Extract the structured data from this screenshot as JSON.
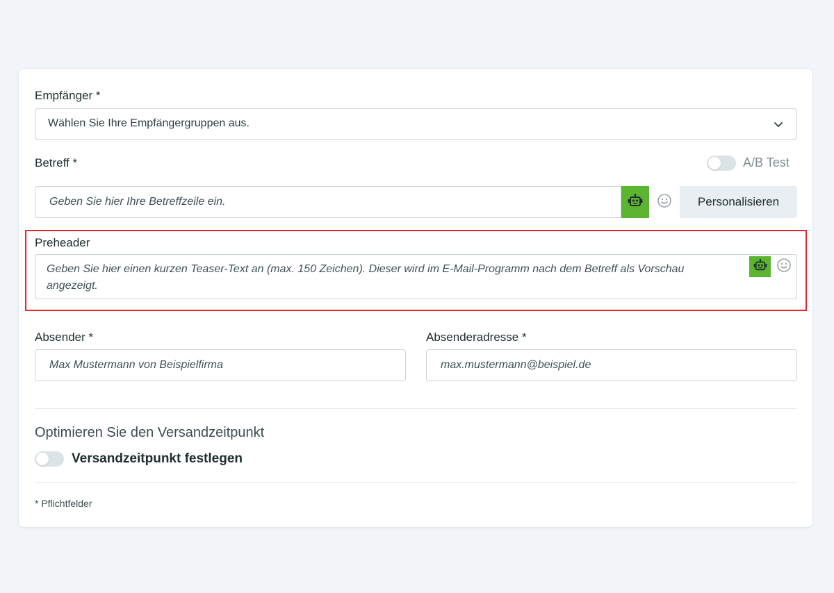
{
  "recipients": {
    "label": "Empfänger *",
    "placeholder": "Wählen Sie Ihre Empfängergruppen aus."
  },
  "subject": {
    "label": "Betreff *",
    "ab_test_label": "A/B Test",
    "placeholder": "Geben Sie hier Ihre Betreffzeile ein.",
    "personalize_label": "Personalisieren"
  },
  "preheader": {
    "label": "Preheader",
    "placeholder": "Geben Sie hier einen kurzen Teaser-Text an (max. 150 Zeichen). Dieser wird im E-Mail-Programm nach dem Betreff als Vorschau angezeigt."
  },
  "sender": {
    "label": "Absender *",
    "placeholder": "Max Mustermann von Beispielfirma"
  },
  "sender_address": {
    "label": "Absenderadresse *",
    "placeholder": "max.mustermann@beispiel.de"
  },
  "send_time": {
    "heading": "Optimieren Sie den Versandzeitpunkt",
    "toggle_label": "Versandzeitpunkt festlegen"
  },
  "footer": {
    "required_note": "* Pflichtfelder"
  },
  "icons": {
    "ai": "robot-icon",
    "emoji": "smiley-icon",
    "dropdown": "chevron-down-icon"
  },
  "colors": {
    "accent_green": "#5cb531",
    "highlight_red": "#e0272a"
  }
}
